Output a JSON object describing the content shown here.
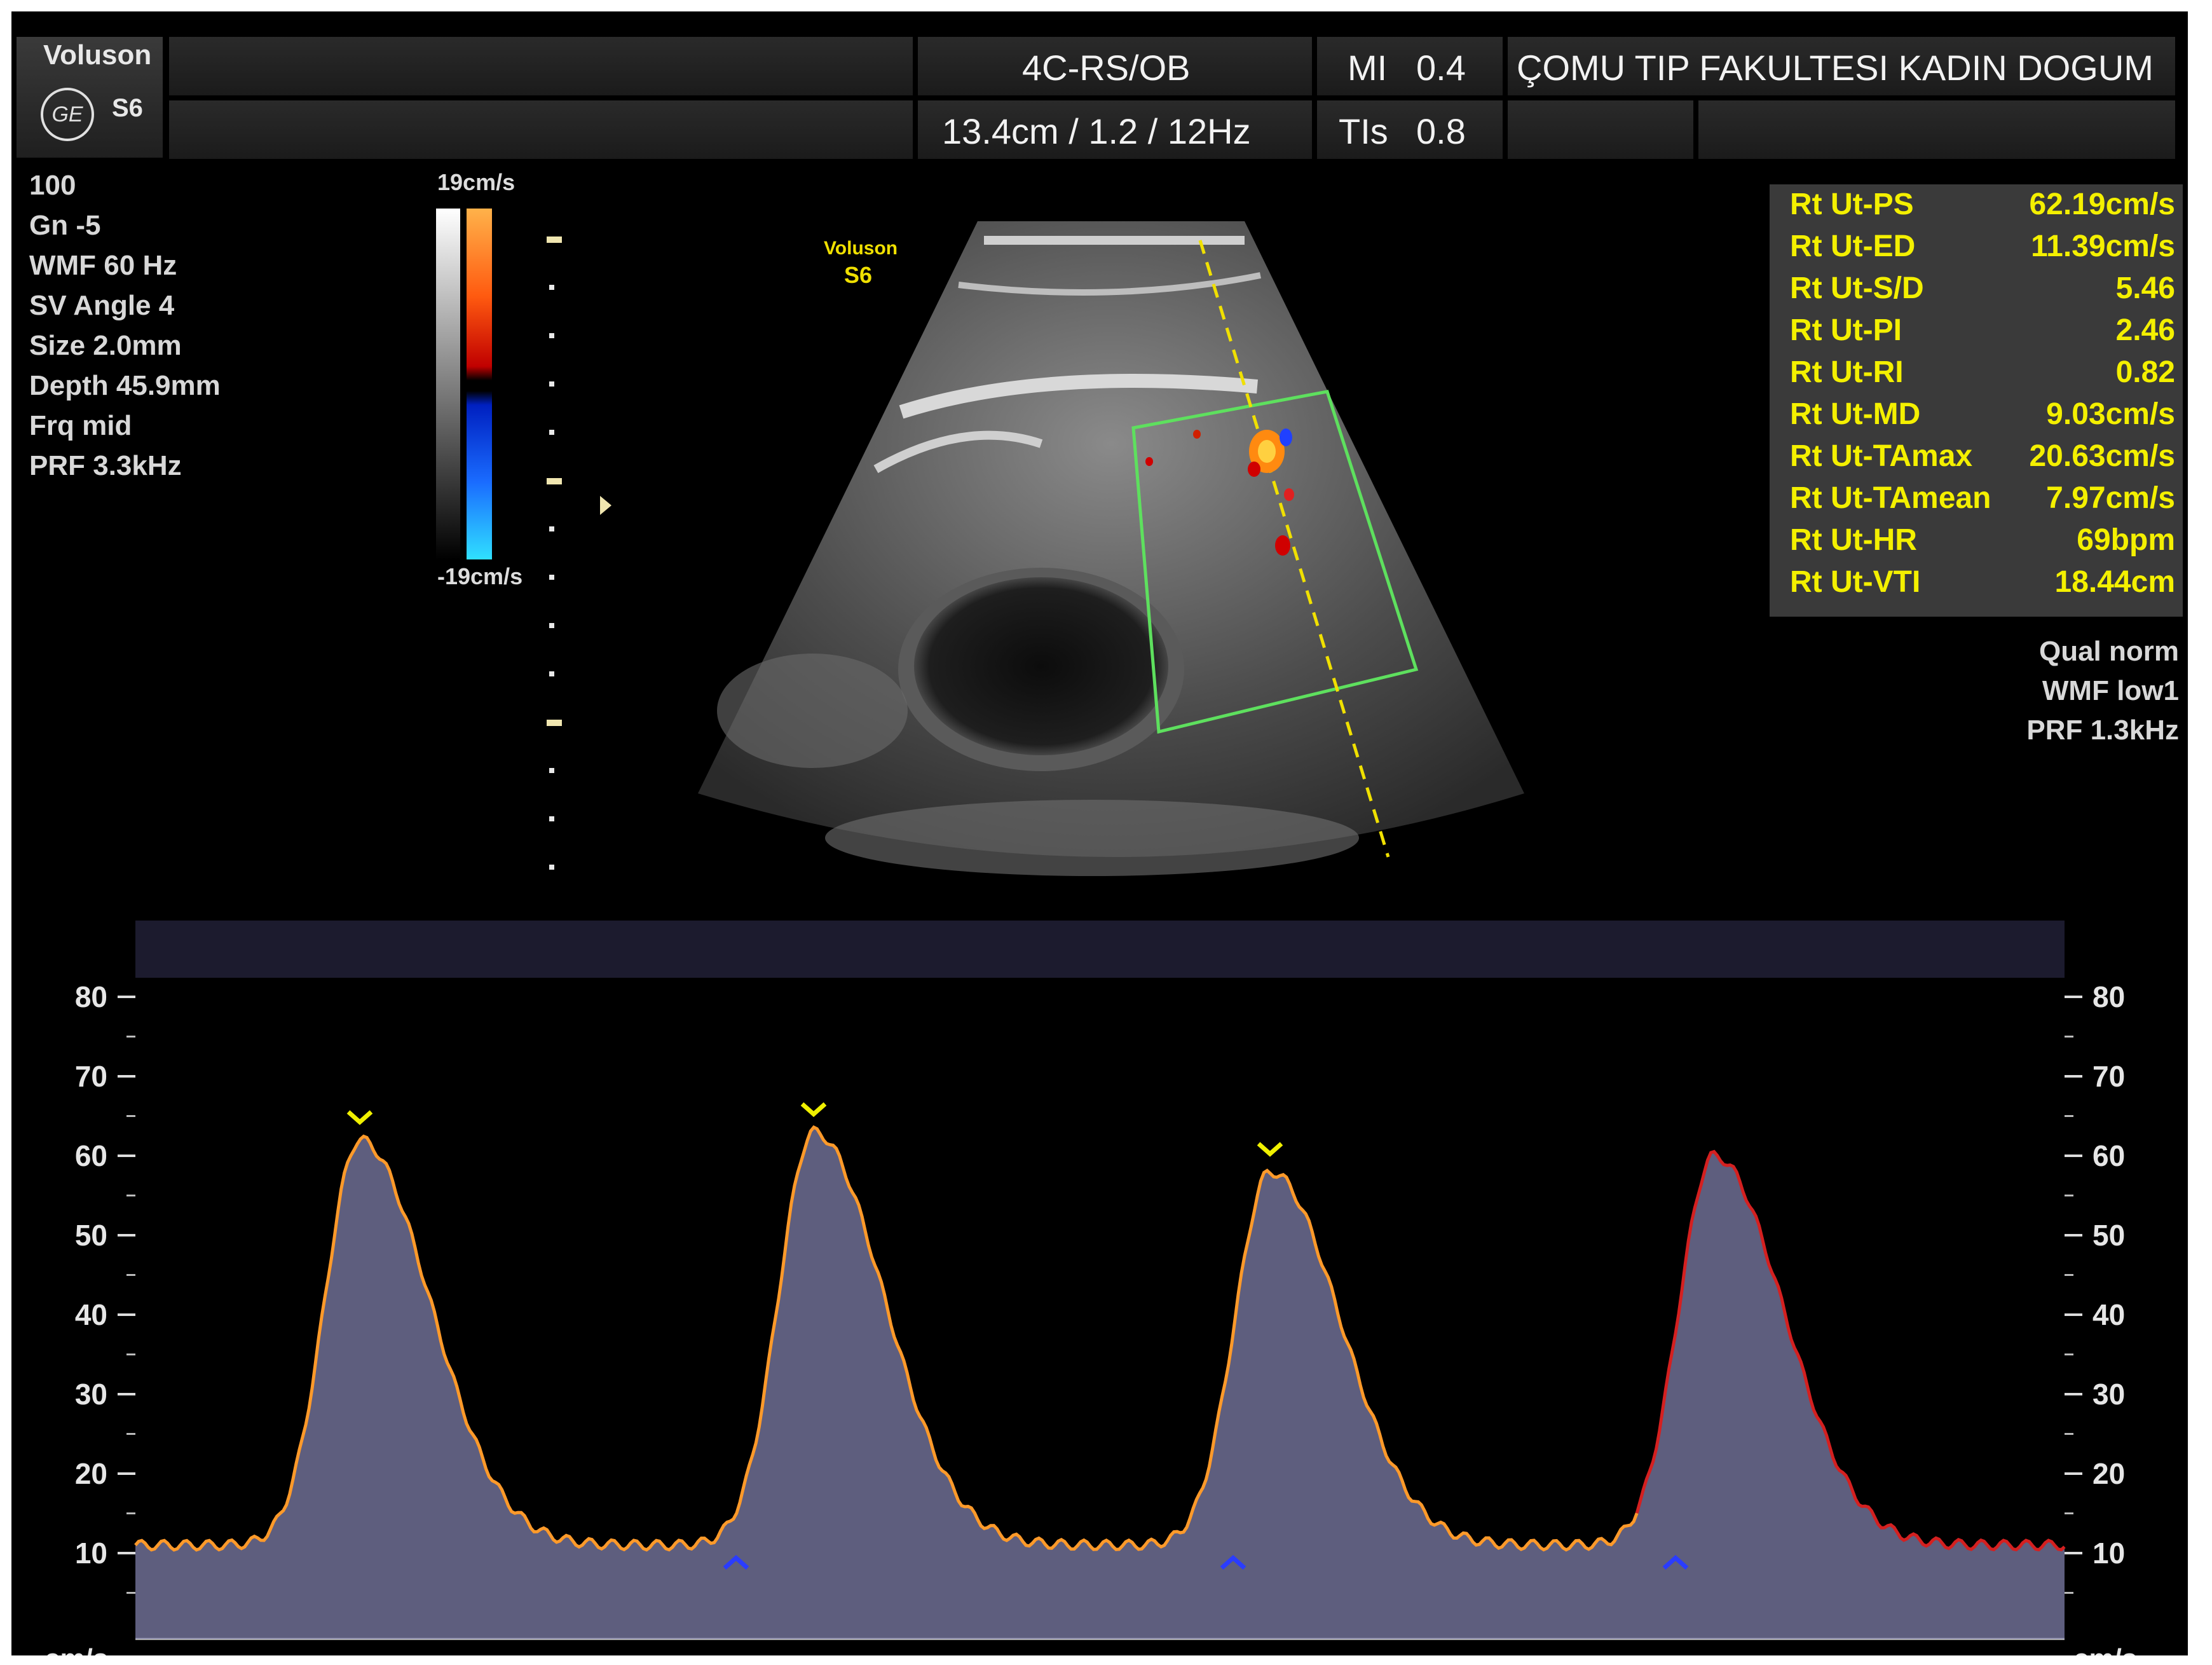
{
  "header": {
    "brand": "Voluson",
    "model": "S6",
    "logo_text": "GE",
    "probe_preset": "4C-RS/OB",
    "mi_label": "MI",
    "mi_value": "0.4",
    "institution": "ÇOMU TIP FAKULTESI KADIN DOGUM",
    "depth_info": "13.4cm / 1.2 / 12Hz",
    "tis_label": "TIs",
    "tis_value": "0.8"
  },
  "left_params": [
    "100",
    "Gn  -5",
    "WMF 60 Hz",
    "SV Angle  4",
    "Size  2.0mm",
    "Depth 45.9mm",
    "Frq mid",
    "PRF  3.3kHz"
  ],
  "color_scale": {
    "top": "19cm/s",
    "bottom": "-19cm/s"
  },
  "image_watermark": {
    "brand": "Voluson",
    "model": "S6"
  },
  "measurements": [
    {
      "label": "Rt Ut-PS",
      "value": "62.19cm/s"
    },
    {
      "label": "Rt Ut-ED",
      "value": "11.39cm/s"
    },
    {
      "label": "Rt Ut-S/D",
      "value": "5.46"
    },
    {
      "label": "Rt Ut-PI",
      "value": "2.46"
    },
    {
      "label": "Rt Ut-RI",
      "value": "0.82"
    },
    {
      "label": "Rt Ut-MD",
      "value": "9.03cm/s"
    },
    {
      "label": "Rt Ut-TAmax",
      "value": "20.63cm/s"
    },
    {
      "label": "Rt Ut-TAmean",
      "value": "7.97cm/s"
    },
    {
      "label": "Rt Ut-HR",
      "value": "69bpm"
    },
    {
      "label": "Rt Ut-VTI",
      "value": "18.44cm"
    }
  ],
  "doppler_params": [
    "Qual norm",
    "WMF low1",
    "PRF  1.3kHz"
  ],
  "spectrum": {
    "unit": "cm/s",
    "ticks": [
      80,
      70,
      60,
      50,
      40,
      30,
      20,
      10
    ],
    "range": [
      0,
      88
    ],
    "peaks": [
      62,
      63,
      58,
      60
    ],
    "baseline": 11,
    "colors": {
      "trace": "#ff9a2a",
      "last_trace": "#d42020",
      "peak_marker": "#f0f000",
      "ed_marker": "#2a3cff",
      "roi": "#5ee05e"
    }
  }
}
